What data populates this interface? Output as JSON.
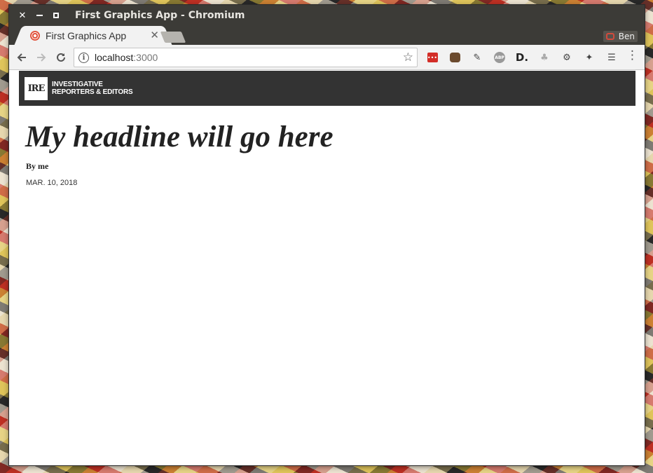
{
  "window": {
    "title": "First Graphics App - Chromium"
  },
  "tabs": [
    {
      "label": "First Graphics App",
      "active": true
    }
  ],
  "profile": {
    "name": "Ben"
  },
  "toolbar": {
    "url_host": "localhost",
    "url_port": ":3000",
    "extension_icons": [
      "lastpass-icon",
      "cat-extension-icon",
      "pin-icon",
      "adblock-plus-icon",
      "d-extension-icon",
      "cloud-icon",
      "settings-gear-icon",
      "pushpin-icon",
      "reader-icon"
    ]
  },
  "page": {
    "logo_mark": "IRE",
    "logo_line1": "INVESTIGATIVE",
    "logo_line2": "REPORTERS & EDITORS",
    "headline": "My headline will go here",
    "byline": "By me",
    "date": "MAR. 10, 2018"
  },
  "colors": {
    "titlebar": "#3c3b37",
    "ire_header": "#333333",
    "favicon": "#e2553f",
    "lastpass": "#d32d27"
  }
}
